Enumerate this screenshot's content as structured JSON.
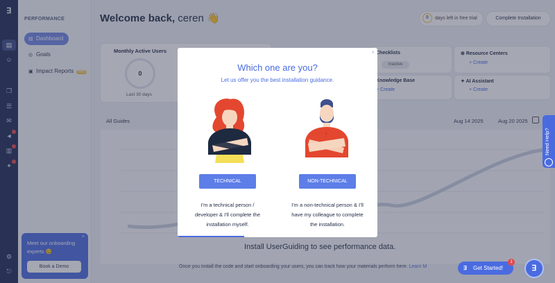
{
  "rail": {
    "logo": "ꓱ"
  },
  "sidebar": {
    "section": "PERFORMANCE",
    "items": [
      {
        "label": "Dashboard",
        "icon": "dashboard-icon",
        "glyph": "▤"
      },
      {
        "label": "Goals",
        "icon": "goal-icon",
        "glyph": "◎"
      },
      {
        "label": "Impact Reports",
        "icon": "report-icon",
        "glyph": "▣",
        "badge": "PRO"
      }
    ],
    "promo": {
      "text": "Meet our onboarding experts 😊",
      "button": "Book a Demo",
      "close": "×"
    }
  },
  "header": {
    "welcome": "Welcome back,",
    "name": "ceren 👋",
    "trial_days": "8",
    "trial_text": "days left in free trial",
    "complete": "Complete Installation"
  },
  "cards": {
    "mau_title": "Monthly Active Users",
    "mau_value": "0",
    "mau_sub": "Last 30 days",
    "checklists": "Checklists",
    "checklists_status": "Inactive",
    "knowledge_base": "Knowledge Base",
    "resource_centers": "Resource Centers",
    "ai_assistant": "AI Assistant",
    "create": "+ Create"
  },
  "guides": {
    "filter": "All Guides",
    "date_from": "Aug 14 2025",
    "date_to": "Aug 20 2025"
  },
  "install": {
    "title": "Install UserGuiding to see performance data.",
    "subtitle": "Once you install the code and start onboarding your users, you can track how your materials perform here.",
    "link": "Learn M"
  },
  "modal": {
    "title": "Which one are you?",
    "subtitle": "Let us offer you the best installation guidance.",
    "close": "×",
    "technical": {
      "button": "TECHNICAL",
      "desc": "I'm a technical person / developer & I'll complete the installation myself."
    },
    "non_technical": {
      "button": "NON-TECHNICAL",
      "desc": "I'm a non-technical person & I'll have my colleague to complete the installation."
    }
  },
  "floating": {
    "need_help": "Need Help?",
    "get_started": "Get Started!",
    "get_started_badge": "1",
    "fab": "ꓱ"
  },
  "colors": {
    "accent": "#4a6be0",
    "navy": "#1e2a55",
    "danger": "#e5484d"
  }
}
